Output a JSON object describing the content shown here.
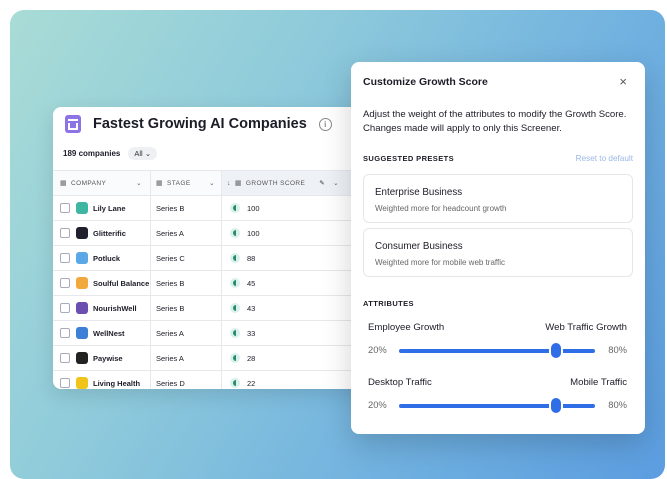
{
  "table": {
    "title": "Fastest Growing AI Companies",
    "count": "189 companies",
    "filter": "All",
    "columns": [
      "COMPANY",
      "STAGE",
      "GROWTH SCORE"
    ],
    "rows": [
      {
        "name": "Lily Lane",
        "stage": "Series B",
        "score": "100",
        "logo_color": "#3fb6a2"
      },
      {
        "name": "Glitterific",
        "stage": "Series A",
        "score": "100",
        "logo_color": "#1f1f2e"
      },
      {
        "name": "Potluck",
        "stage": "Series C",
        "score": "88",
        "logo_color": "#5aa8e6"
      },
      {
        "name": "Soulful Balance",
        "stage": "Series B",
        "score": "45",
        "logo_color": "#f2a93b"
      },
      {
        "name": "NourishWell",
        "stage": "Series B",
        "score": "43",
        "logo_color": "#6a4fb0"
      },
      {
        "name": "WellNest",
        "stage": "Series A",
        "score": "33",
        "logo_color": "#3d7fd6"
      },
      {
        "name": "Paywise",
        "stage": "Series A",
        "score": "28",
        "logo_color": "#222222"
      },
      {
        "name": "Living Health",
        "stage": "Series D",
        "score": "22",
        "logo_color": "#f0c419"
      }
    ]
  },
  "modal": {
    "title": "Customize Growth Score",
    "close": "×",
    "description": "Adjust the weight of the attributes to modify the Growth Score. Changes made will apply to only this Screener.",
    "presets_heading": "SUGGESTED PRESETS",
    "reset": "Reset to default",
    "presets": [
      {
        "name": "Enterprise Business",
        "desc": "Weighted more for headcount growth"
      },
      {
        "name": "Consumer Business",
        "desc": "Weighted more for mobile web traffic"
      }
    ],
    "attributes_heading": "ATTRIBUTES",
    "attributes": [
      {
        "left": "Employee Growth",
        "right": "Web Traffic Growth",
        "left_pct": "20%",
        "right_pct": "80%",
        "value": 0.8
      },
      {
        "left": "Desktop Traffic",
        "right": "Mobile Traffic",
        "left_pct": "20%",
        "right_pct": "80%",
        "value": 0.8
      }
    ]
  }
}
